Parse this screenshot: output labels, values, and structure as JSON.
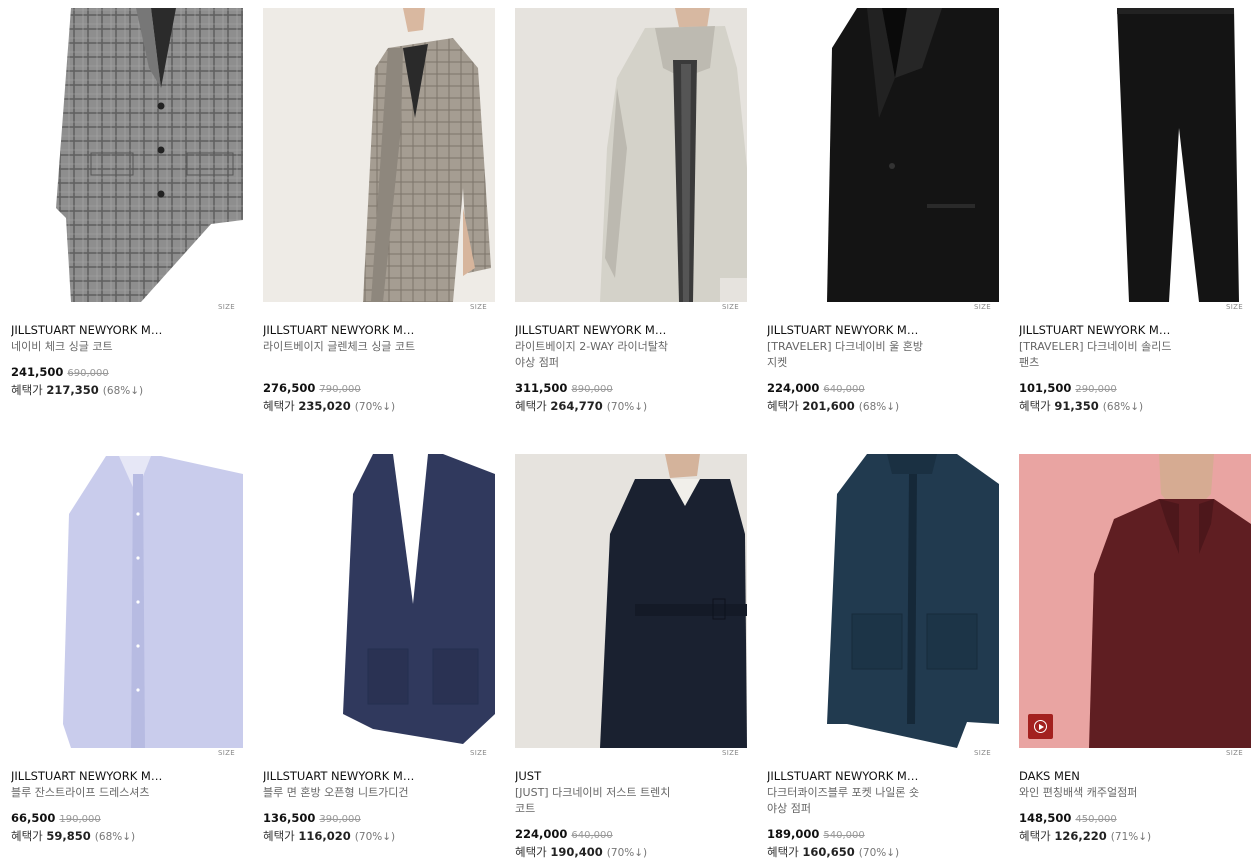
{
  "size_label": "SIZE",
  "benefit_label": "혜택가",
  "products": [
    {
      "brand": "JILLSTUART NEWYORK M…",
      "name": "네이비 체크 싱글 코트",
      "price": "241,500",
      "original": "690,000",
      "benefit": "217,350",
      "rate": "(68%↓)",
      "image": "gray-check-coat"
    },
    {
      "brand": "JILLSTUART NEWYORK M…",
      "name": "라이트베이지 글렌체크 싱글 코트",
      "price": "276,500",
      "original": "790,000",
      "benefit": "235,020",
      "rate": "(70%↓)",
      "image": "beige-check-coat-model"
    },
    {
      "brand": "JILLSTUART NEWYORK M…",
      "name": "라이트베이지 2-WAY 라이너탈착 야상 점퍼",
      "price": "311,500",
      "original": "890,000",
      "benefit": "264,770",
      "rate": "(70%↓)",
      "image": "beige-parka-model"
    },
    {
      "brand": "JILLSTUART NEWYORK M…",
      "name": "[TRAVELER] 다크네이비 울 혼방 지켓",
      "price": "224,000",
      "original": "640,000",
      "benefit": "201,600",
      "rate": "(68%↓)",
      "image": "dark-navy-jacket"
    },
    {
      "brand": "JILLSTUART NEWYORK M…",
      "name": "[TRAVELER] 다크네이비 솔리드 팬츠",
      "price": "101,500",
      "original": "290,000",
      "benefit": "91,350",
      "rate": "(68%↓)",
      "image": "dark-navy-pants"
    },
    {
      "brand": "JILLSTUART NEWYORK M…",
      "name": "블루 잔스트라이프 드레스셔츠",
      "price": "66,500",
      "original": "190,000",
      "benefit": "59,850",
      "rate": "(68%↓)",
      "image": "blue-dress-shirt"
    },
    {
      "brand": "JILLSTUART NEWYORK M…",
      "name": "블루 면 혼방 오픈형 니트가디건",
      "price": "136,500",
      "original": "390,000",
      "benefit": "116,020",
      "rate": "(70%↓)",
      "image": "navy-knit-cardigan"
    },
    {
      "brand": "JUST",
      "name": "[JUST] 다크네이비 저스트 트렌치 코트",
      "price": "224,000",
      "original": "640,000",
      "benefit": "190,400",
      "rate": "(70%↓)",
      "image": "navy-trench-model"
    },
    {
      "brand": "JILLSTUART NEWYORK M…",
      "name": "다크터콰이즈블루 포켓 나일론 숏 야상 점퍼",
      "price": "189,000",
      "original": "540,000",
      "benefit": "160,650",
      "rate": "(70%↓)",
      "image": "teal-field-jacket"
    },
    {
      "brand": "DAKS MEN",
      "name": "와인 편칭배색 캐주얼점퍼",
      "price": "148,500",
      "original": "450,000",
      "benefit": "126,220",
      "rate": "(71%↓)",
      "image": "wine-jacket-model",
      "video": "play-icon"
    }
  ]
}
